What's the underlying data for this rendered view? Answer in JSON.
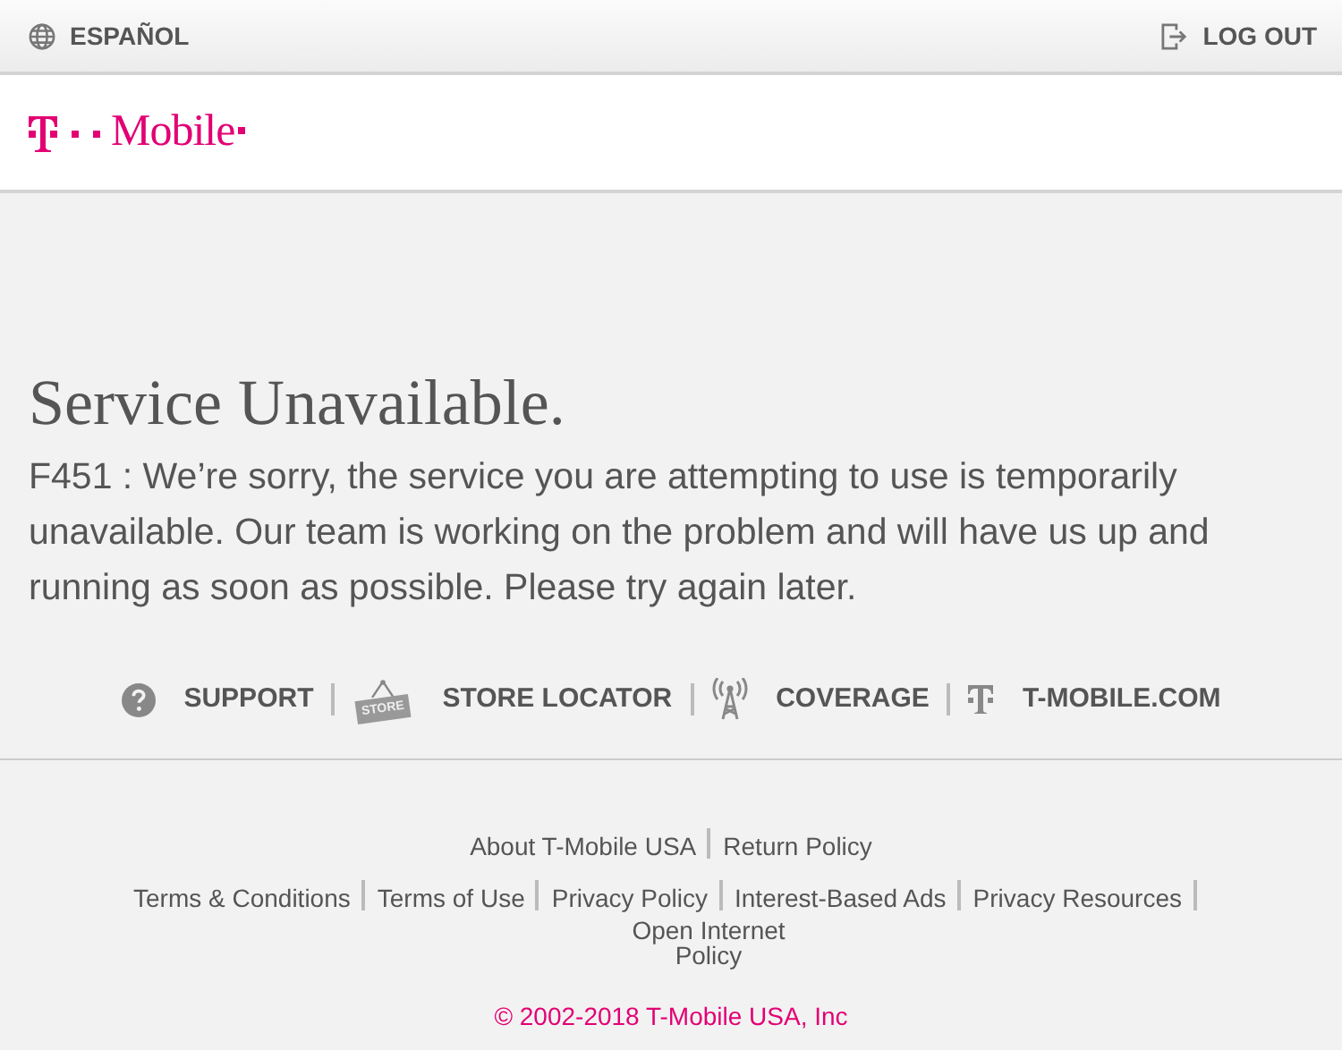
{
  "top_bar": {
    "language_link": "ESPAÑOL",
    "logout_link": "LOG OUT"
  },
  "header": {
    "logo_text": "Mobile"
  },
  "error": {
    "title": "Service Unavailable.",
    "message": "F451 : We’re sorry, the service you are attempting to use is temporarily unavailable. Our team is working on the problem and will have us up and running as soon as possible. Please try again later."
  },
  "quick_links": [
    {
      "kind": "support",
      "label": "SUPPORT"
    },
    {
      "kind": "store",
      "label": "STORE LOCATOR",
      "icon_text": "STORE"
    },
    {
      "kind": "coverage",
      "label": "COVERAGE"
    },
    {
      "kind": "tmobile",
      "label": "T-MOBILE.COM"
    }
  ],
  "footer": {
    "link_rows": [
      [
        "About T-Mobile USA",
        "Return Policy"
      ],
      [
        "Terms & Conditions",
        "Terms of Use",
        "Privacy Policy",
        "Interest-Based Ads",
        "Privacy Resources",
        "Open Internet Policy"
      ]
    ],
    "copyright": "© 2002-2018 T-Mobile USA, Inc"
  }
}
